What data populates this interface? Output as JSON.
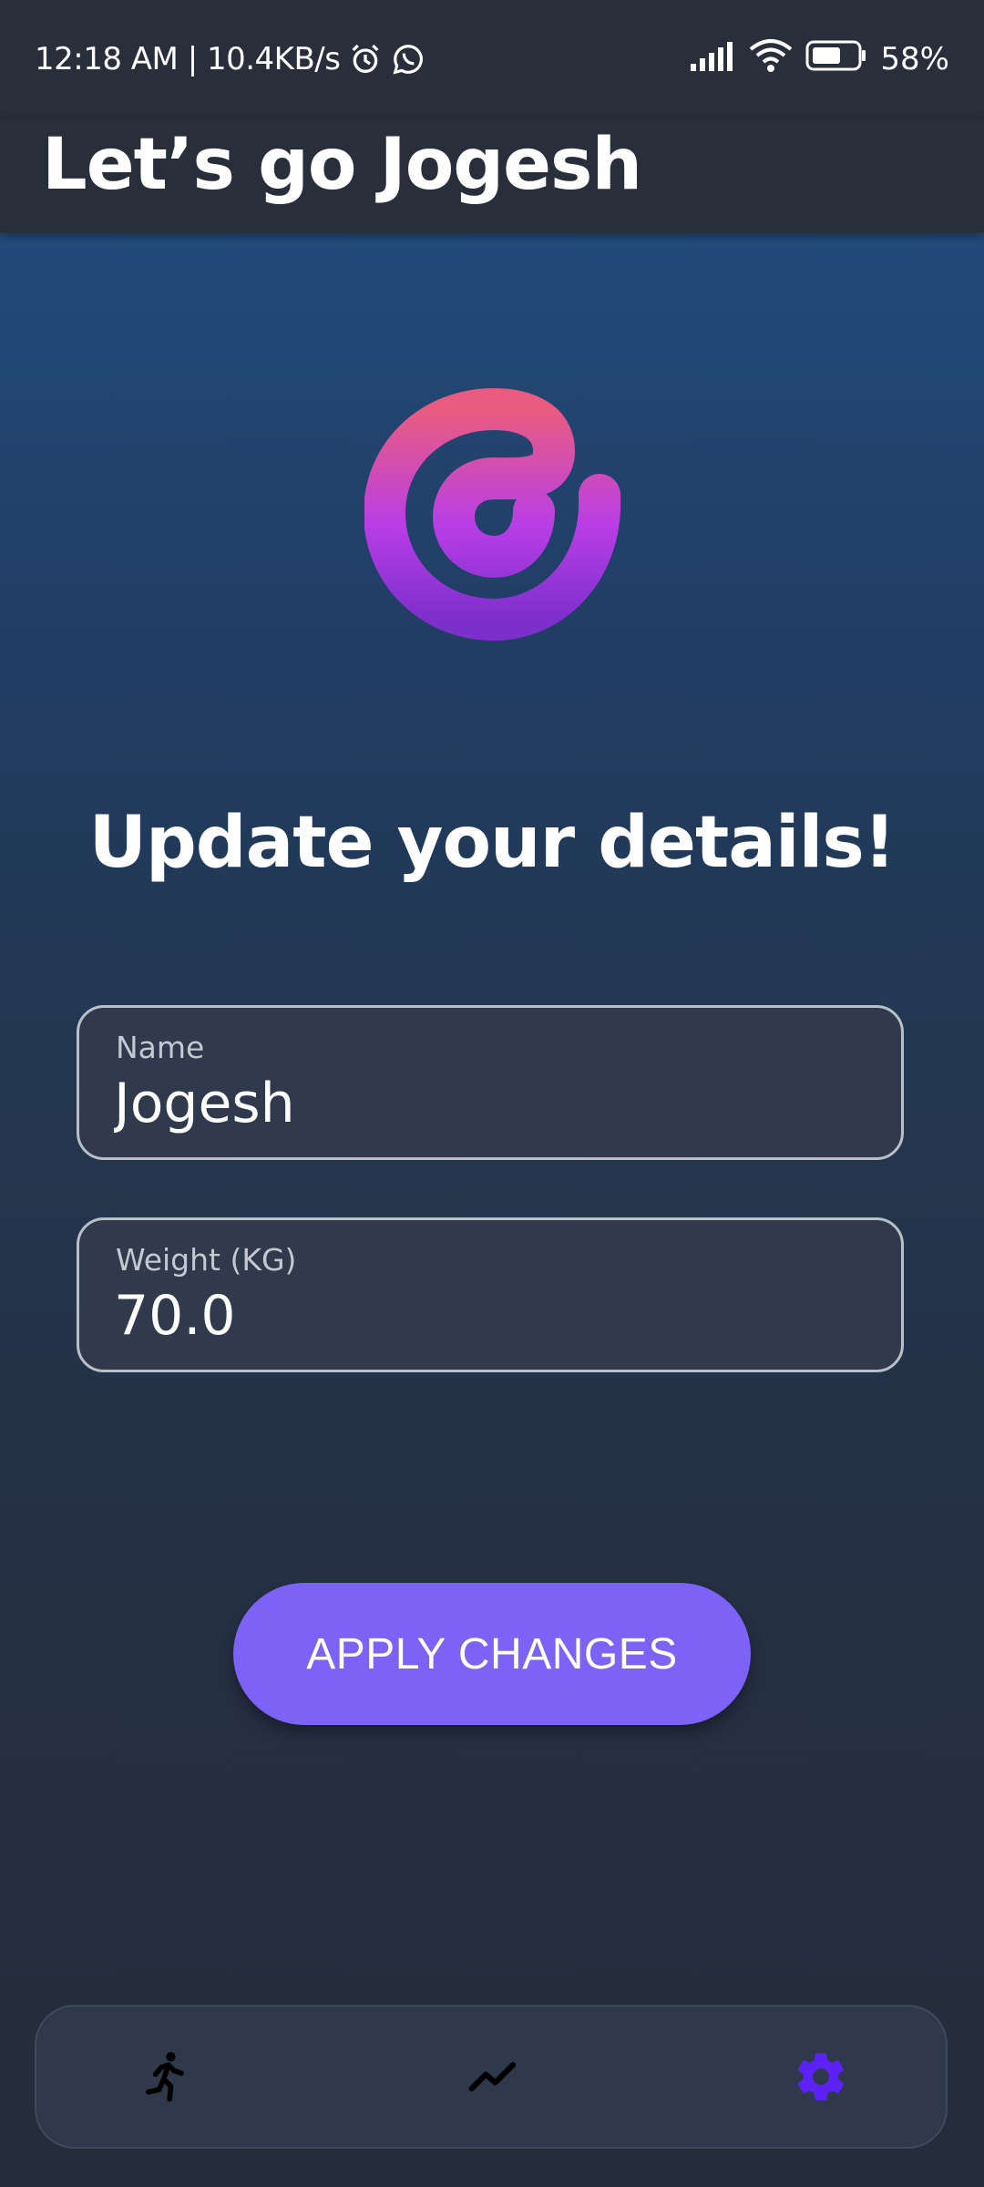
{
  "status_bar": {
    "time": "12:18 AM",
    "speed": "10.4KB/s",
    "battery": "58%",
    "icons": [
      "alarm-icon",
      "whatsapp-icon",
      "signal-icon",
      "wifi-icon",
      "battery-icon"
    ]
  },
  "app_bar": {
    "title": "Let’s go Jogesh"
  },
  "logo": {
    "icon": "app-logo-swirl",
    "colors": [
      "#e95c8a",
      "#b03fe5",
      "#7a2ccb"
    ]
  },
  "main": {
    "heading": "Update your details!",
    "fields": [
      {
        "label": "Name",
        "value": "Jogesh"
      },
      {
        "label": "Weight (KG)",
        "value": "70.0"
      }
    ],
    "apply_label": "APPLY CHANGES"
  },
  "bottom_nav": {
    "items": [
      {
        "icon": "running-icon",
        "active": false
      },
      {
        "icon": "trending-chart-icon",
        "active": false
      },
      {
        "icon": "settings-gear-icon",
        "active": true
      }
    ],
    "active_color": "#5b21f5",
    "inactive_color": "#000000"
  },
  "colors": {
    "accent": "#7c63f5",
    "appbar": "#282f3b"
  }
}
